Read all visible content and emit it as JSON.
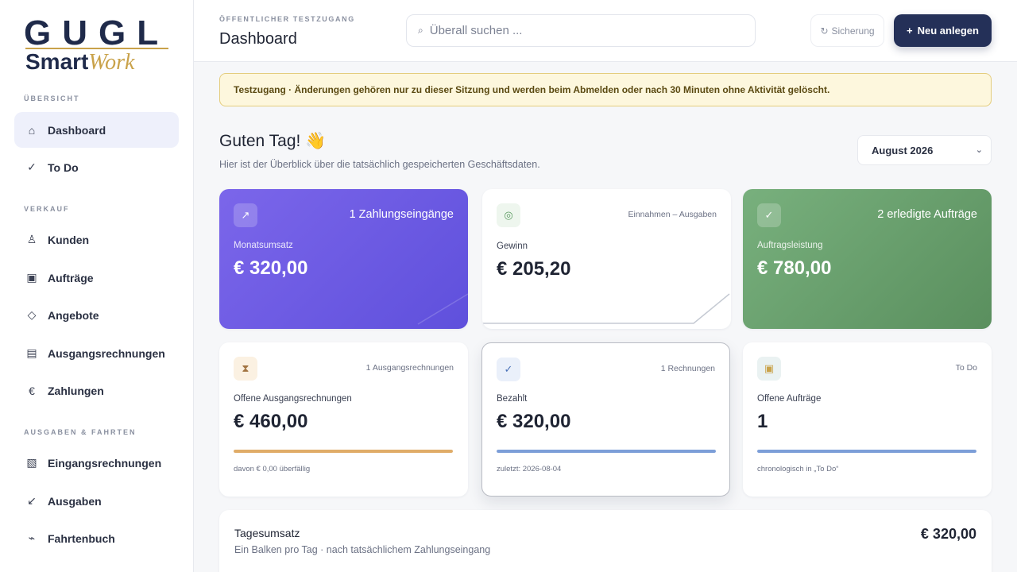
{
  "logo": {
    "top": "GUGL",
    "smart": "Smart",
    "work": "Work"
  },
  "sidebar": {
    "sections": [
      {
        "label": "ÜBERSICHT"
      },
      {
        "label": "VERKAUF"
      },
      {
        "label": "AUSGABEN & FAHRTEN"
      }
    ],
    "items": [
      {
        "label": "Dashboard",
        "icon": "⌂"
      },
      {
        "label": "To Do",
        "icon": "✓"
      },
      {
        "label": "Kunden",
        "icon": "♙"
      },
      {
        "label": "Aufträge",
        "icon": "▣"
      },
      {
        "label": "Angebote",
        "icon": "◇"
      },
      {
        "label": "Ausgangsrechnungen",
        "icon": "▤"
      },
      {
        "label": "Zahlungen",
        "icon": "€"
      },
      {
        "label": "Eingangsrechnungen",
        "icon": "▧"
      },
      {
        "label": "Ausgaben",
        "icon": "↙"
      },
      {
        "label": "Fahrtenbuch",
        "icon": "⌁"
      }
    ]
  },
  "header": {
    "eyebrow": "ÖFFENTLICHER TESTZUGANG",
    "title": "Dashboard",
    "search_placeholder": "Überall suchen ...",
    "search_icon": "⌕",
    "backup_icon": "↻",
    "backup_label": "Sicherung",
    "new_icon": "+",
    "new_label": "Neu anlegen"
  },
  "banner": "Testzugang · Änderungen gehören nur zu dieser Sitzung und werden beim Abmelden oder nach 30 Minuten ohne Aktivität gelöscht.",
  "greeting": {
    "title": "Guten Tag! 👋",
    "subtitle": "Hier ist der Überblick über die tatsächlich gespeicherten Geschäftsdaten.",
    "month": "August 2026",
    "month_chevron": "⌄"
  },
  "cards": [
    {
      "icon": "↗",
      "meta": "1 Zahlungseingänge",
      "label": "Monatsumsatz",
      "value": "€ 320,00"
    },
    {
      "icon": "◎",
      "meta": "Einnahmen – Ausgaben",
      "label": "Gewinn",
      "value": "€ 205,20"
    },
    {
      "icon": "✓",
      "meta": "2 erledigte Aufträge",
      "label": "Auftragsleistung",
      "value": "€ 780,00"
    },
    {
      "icon": "⧗",
      "meta": "1 Ausgangsrechnungen",
      "label": "Offene Ausgangsrechnungen",
      "value": "€ 460,00",
      "foot": "davon € 0,00 überfällig",
      "progress": 1.0,
      "color": "#e0ac68"
    },
    {
      "icon": "✓",
      "meta": "1 Rechnungen",
      "label": "Bezahlt",
      "value": "€ 320,00",
      "foot": "zuletzt: 2026-08-04",
      "progress": 1.0,
      "color": "#7c9ed8"
    },
    {
      "icon": "▣",
      "meta": "To Do",
      "label": "Offene Aufträge",
      "value": "1",
      "foot": "chronologisch in „To Do“",
      "progress": 1.0,
      "color": "#7c9ed8"
    }
  ],
  "panel": {
    "title": "Tagesumsatz",
    "subtitle": "Ein Balken pro Tag · nach tatsächlichem Zahlungseingang",
    "value": "€ 320,00"
  }
}
